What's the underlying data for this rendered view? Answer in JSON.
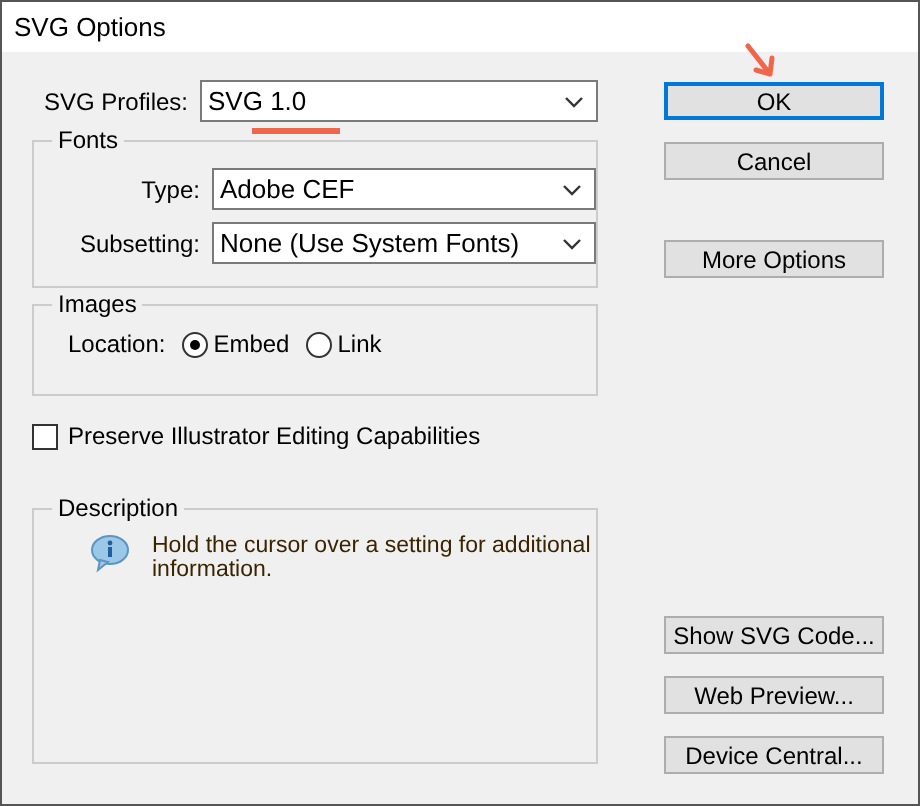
{
  "window": {
    "title": "SVG Options"
  },
  "profiles": {
    "label": "SVG Profiles:",
    "value": "SVG 1.0"
  },
  "fonts": {
    "title": "Fonts",
    "fields": [
      {
        "label": "Type:",
        "value": "Adobe CEF"
      },
      {
        "label": "Subsetting:",
        "value": "None (Use System Fonts)"
      }
    ]
  },
  "images": {
    "title": "Images",
    "label": "Location:",
    "options": [
      {
        "label": "Embed",
        "selected": true
      },
      {
        "label": "Link",
        "selected": false
      }
    ]
  },
  "preserve": {
    "label": "Preserve Illustrator Editing Capabilities",
    "checked": false
  },
  "description": {
    "title": "Description",
    "text": "Hold the cursor over a setting for additional information."
  },
  "top_buttons": [
    {
      "label": "OK",
      "default": true
    },
    {
      "label": "Cancel",
      "default": false
    },
    {
      "label": "More Options",
      "default": false
    }
  ],
  "bottom_buttons": [
    {
      "label": "Show SVG Code...",
      "default": false
    },
    {
      "label": "Web Preview...",
      "default": false
    },
    {
      "label": "Device Central...",
      "default": false
    }
  ]
}
